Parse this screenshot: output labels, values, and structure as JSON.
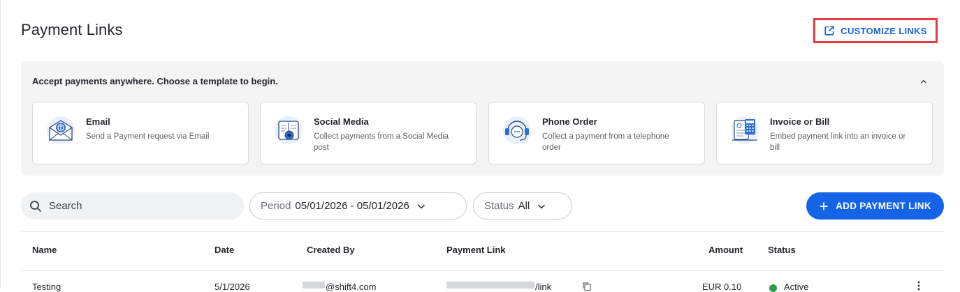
{
  "header": {
    "title": "Payment Links",
    "customize_label": "CUSTOMIZE LINKS"
  },
  "templates": {
    "heading": "Accept payments anywhere. Choose a template to begin.",
    "cards": [
      {
        "icon": "email-icon",
        "title": "Email",
        "description": "Send a Payment request via Email"
      },
      {
        "icon": "social-media-icon",
        "title": "Social Media",
        "description": "Collect payments from a Social Media post"
      },
      {
        "icon": "phone-order-icon",
        "title": "Phone Order",
        "description": "Collect a payment from a telephone order"
      },
      {
        "icon": "invoice-icon",
        "title": "Invoice or Bill",
        "description": "Embed payment link into an invoice or bill"
      }
    ]
  },
  "toolbar": {
    "search_placeholder": "Search",
    "period_label": "Period",
    "period_value": "05/01/2026 - 05/01/2026",
    "status_label": "Status",
    "status_value": "All",
    "add_label": "ADD PAYMENT LINK"
  },
  "table": {
    "columns": [
      "Name",
      "Date",
      "Created By",
      "Payment Link",
      "Amount",
      "Status"
    ],
    "rows": [
      {
        "name": "Testing",
        "date": "5/1/2026",
        "created_by": "@shift4.com",
        "payment_link": "/link",
        "amount": "EUR 0.10",
        "status": "Active"
      }
    ]
  },
  "colors": {
    "accent": "#1563e6",
    "highlight_border": "#e83b43",
    "active_status": "#2e9e44"
  }
}
